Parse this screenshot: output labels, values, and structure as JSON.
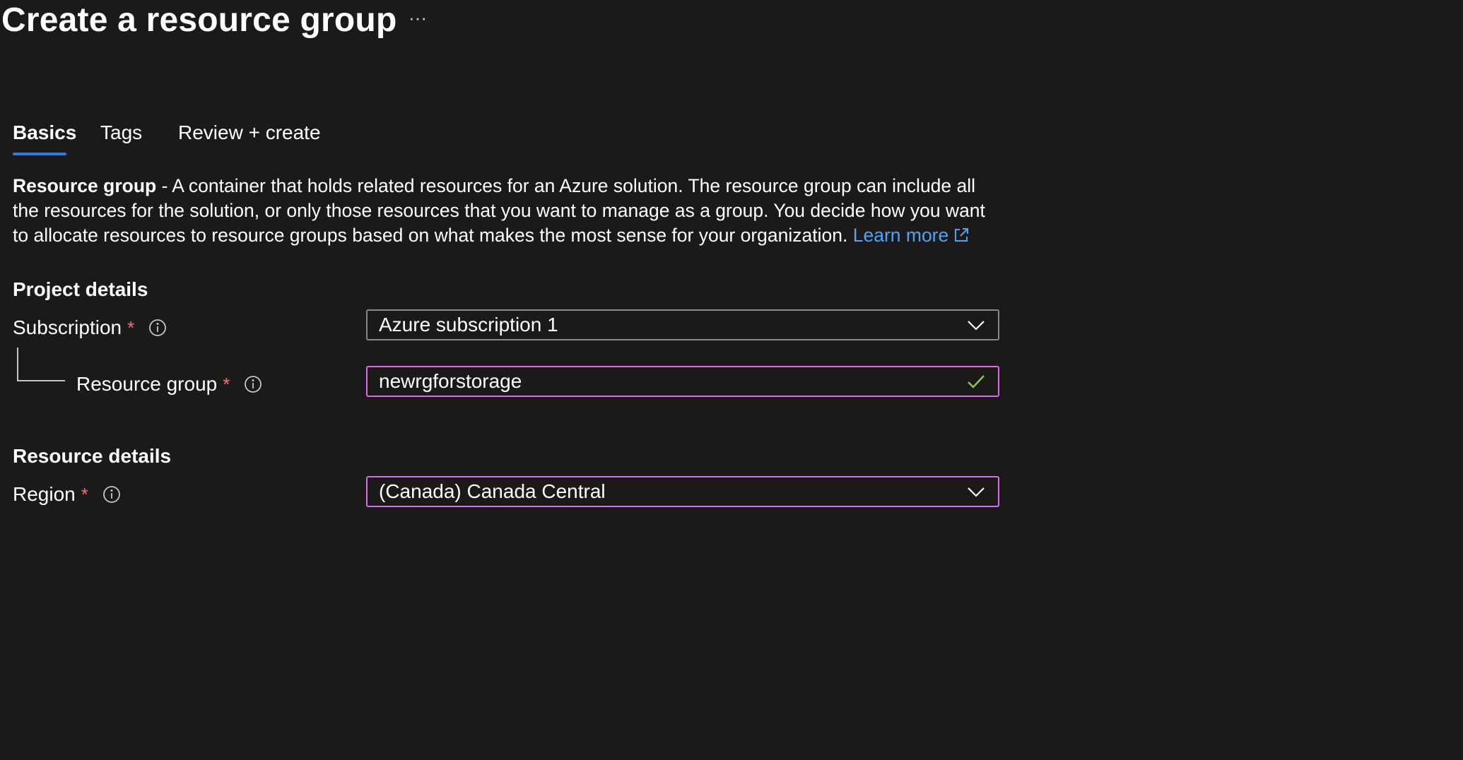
{
  "header": {
    "title": "Create a resource group",
    "more_label": "···"
  },
  "tabs": [
    {
      "label": "Basics",
      "active": true
    },
    {
      "label": "Tags",
      "active": false
    },
    {
      "label": "Review + create",
      "active": false
    }
  ],
  "description": {
    "bold_term": "Resource group",
    "text": " - A container that holds related resources for an Azure solution. The resource group can include all the resources for the solution, or only those resources that you want to manage as a group. You decide how you want to allocate resources to resource groups based on what makes the most sense for your organization. ",
    "learn_more": "Learn more"
  },
  "project_details": {
    "heading": "Project details",
    "subscription": {
      "label": "Subscription",
      "required_mark": "*",
      "value": "Azure subscription 1"
    },
    "resource_group": {
      "label": "Resource group",
      "required_mark": "*",
      "value": "newrgforstorage"
    }
  },
  "resource_details": {
    "heading": "Resource details",
    "region": {
      "label": "Region",
      "required_mark": "*",
      "value": "(Canada) Canada Central"
    }
  },
  "colors": {
    "background": "#1b1a19",
    "accent_tab": "#2f7de1",
    "link": "#4fa3f7",
    "required": "#f1707b",
    "focus_border": "#d36ff0",
    "valid_check": "#92c353"
  },
  "icons": {
    "more": "ellipsis-icon",
    "info": "info-icon",
    "dropdown": "chevron-down-icon",
    "valid": "checkmark-icon",
    "external": "external-link-icon"
  }
}
